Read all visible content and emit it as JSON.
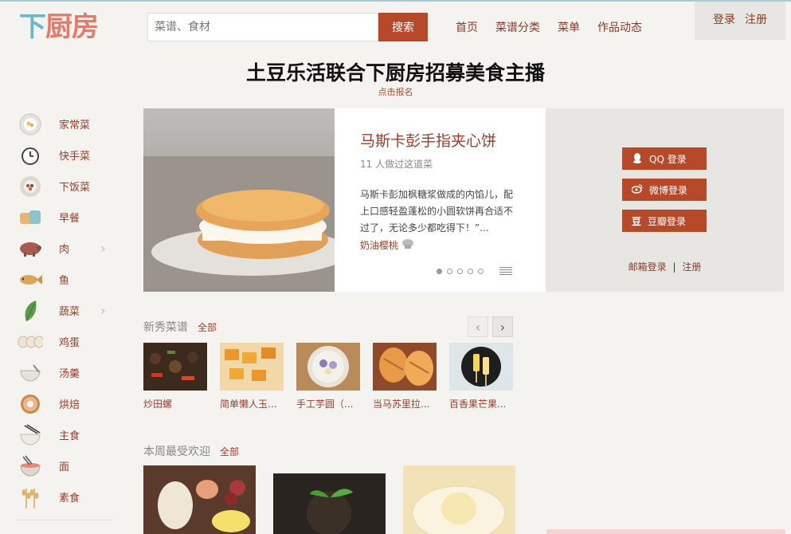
{
  "header": {
    "logo": "下厨房",
    "search_placeholder": "菜谱、食材",
    "search_button": "搜索",
    "nav": [
      "首页",
      "菜谱分类",
      "菜单",
      "作品动态"
    ],
    "login": "登录",
    "register": "注册"
  },
  "promo": {
    "title": "土豆乐活联合下厨房招募美食主播",
    "link": "点击报名"
  },
  "sidebar": {
    "items": [
      {
        "label": "家常菜",
        "icon": "plate-icon",
        "arrow": false
      },
      {
        "label": "快手菜",
        "icon": "clock-icon",
        "arrow": false
      },
      {
        "label": "下饭菜",
        "icon": "bowl-icon",
        "arrow": false
      },
      {
        "label": "早餐",
        "icon": "cup-icon",
        "arrow": false
      },
      {
        "label": "肉",
        "icon": "pig-icon",
        "arrow": true
      },
      {
        "label": "鱼",
        "icon": "fish-icon",
        "arrow": false
      },
      {
        "label": "蔬菜",
        "icon": "leaf-icon",
        "arrow": true
      },
      {
        "label": "鸡蛋",
        "icon": "egg-icon",
        "arrow": false
      },
      {
        "label": "汤羹",
        "icon": "soup-icon",
        "arrow": false
      },
      {
        "label": "烘焙",
        "icon": "donut-icon",
        "arrow": false
      },
      {
        "label": "主食",
        "icon": "rice-bowl-icon",
        "arrow": false
      },
      {
        "label": "面",
        "icon": "noodle-icon",
        "arrow": false
      },
      {
        "label": "素食",
        "icon": "wheat-icon",
        "arrow": false
      }
    ]
  },
  "feature": {
    "title": "马斯卡彭手指夹心饼",
    "count": "11 人做过这道菜",
    "desc": "马斯卡彭加枫糖浆做成的内馅儿，配上口感轻盈蓬松的小圆软饼再合适不过了，无论多少都吃得下！”...",
    "author": "奶油樱桃",
    "dots": 5,
    "active_dot": 0
  },
  "social": {
    "qq": "QQ 登录",
    "weibo": "微博登录",
    "douban": "豆瓣登录",
    "mail": "邮箱登录",
    "sep": "|",
    "register": "注册"
  },
  "new_recipes": {
    "title": "新秀菜谱",
    "all": "全部",
    "items": [
      "炒田螺",
      "简单懒人玉...",
      "手工芋圆（...",
      "当马苏里拉...",
      "百香果芒果..."
    ]
  },
  "popular": {
    "title": "本周最受欢迎",
    "all": "全部"
  },
  "colors": {
    "accent": "#b8482a",
    "link": "#9a3c2a"
  }
}
